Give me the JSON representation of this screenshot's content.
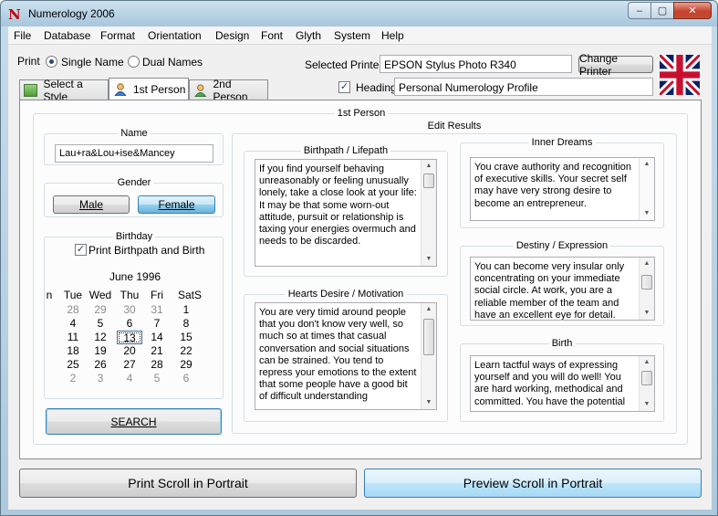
{
  "window": {
    "title": "Numerology 2006",
    "buttons": {
      "minimize": "–",
      "maximize": "▢",
      "close": "✕"
    }
  },
  "menu": [
    "File",
    "Database",
    "Format",
    "Orientation",
    "Design",
    "Font",
    "Glyth",
    "System",
    "Help"
  ],
  "print": {
    "label": "Print",
    "options": [
      {
        "label": "Single Name",
        "selected": true
      },
      {
        "label": "Dual Names",
        "selected": false
      }
    ],
    "selected_printer_label": "Selected Printer",
    "printer_value": "EPSON Stylus Photo R340",
    "change_printer_label": "Change Printer",
    "heading_label": "Heading",
    "heading_checked": true,
    "heading_value": "Personal Numerology Profile"
  },
  "tabs": [
    {
      "label": "Select a Style",
      "icon": "style-icon"
    },
    {
      "label": "1st Person",
      "icon": "person-icon",
      "active": true
    },
    {
      "label": "2nd Person",
      "icon": "person-icon"
    }
  ],
  "panel": {
    "title": "1st Person",
    "name_group": {
      "title": "Name",
      "value": "Lau+ra&Lou+ise&Mancey"
    },
    "gender_group": {
      "title": "Gender",
      "male": "Male",
      "female": "Female",
      "selected": "Female"
    },
    "birthday_group": {
      "title": "Birthday",
      "checkbox_label": "Print Birthpath and Birth",
      "checked": true,
      "month": "June 1996",
      "day_headers": [
        "n",
        "Tue",
        "Wed",
        "Thu",
        "Fri",
        "Sat",
        "S"
      ],
      "weeks": [
        [
          "28",
          "29",
          "30",
          "31",
          "1"
        ],
        [
          "4",
          "5",
          "6",
          "7",
          "8"
        ],
        [
          "11",
          "12",
          "13",
          "14",
          "15"
        ],
        [
          "18",
          "19",
          "20",
          "21",
          "22"
        ],
        [
          "25",
          "26",
          "27",
          "28",
          "29"
        ],
        [
          "2",
          "3",
          "4",
          "5",
          "6"
        ]
      ],
      "selected_day": "13"
    },
    "search_label": "SEARCH",
    "edit_results_title": "Edit Results",
    "results": {
      "birthpath": {
        "title": "Birthpath / Lifepath",
        "text": "If you find yourself behaving unreasonably or feeling unusually lonely, take a close look at your life: It may be that some worn-out attitude, pursuit or relationship is taxing your energies overmuch and needs to be discarded."
      },
      "hearts_desire": {
        "title": "Hearts Desire / Motivation",
        "text": "You are very timid around people that you don't know very well, so much so at times that casual conversation and social situations can be strained. You tend to repress your emotions to the extent that some people have a good bit of difficult understanding"
      },
      "inner_dreams": {
        "title": "Inner Dreams",
        "text": "You crave authority and recognition of executive skills. Your secret self may have very strong desire to become an entrepreneur."
      },
      "destiny": {
        "title": "Destiny / Expression",
        "text": "You can become very insular only concentrating on your immediate social circle. At work, you are a reliable member of the team and have an excellent eye for detail."
      },
      "birth": {
        "title": "Birth",
        "text": "Learn tactful ways of expressing yourself and you will do well! You are hard working, methodical and committed. You have the potential"
      }
    }
  },
  "bottom": {
    "print_label": "Print Scroll in Portrait",
    "preview_label": "Preview Scroll in Portrait"
  },
  "colors": {
    "title_bar": "#b9d3e6",
    "accent_button": "#98d1ef",
    "close_button": "#c5432c"
  }
}
